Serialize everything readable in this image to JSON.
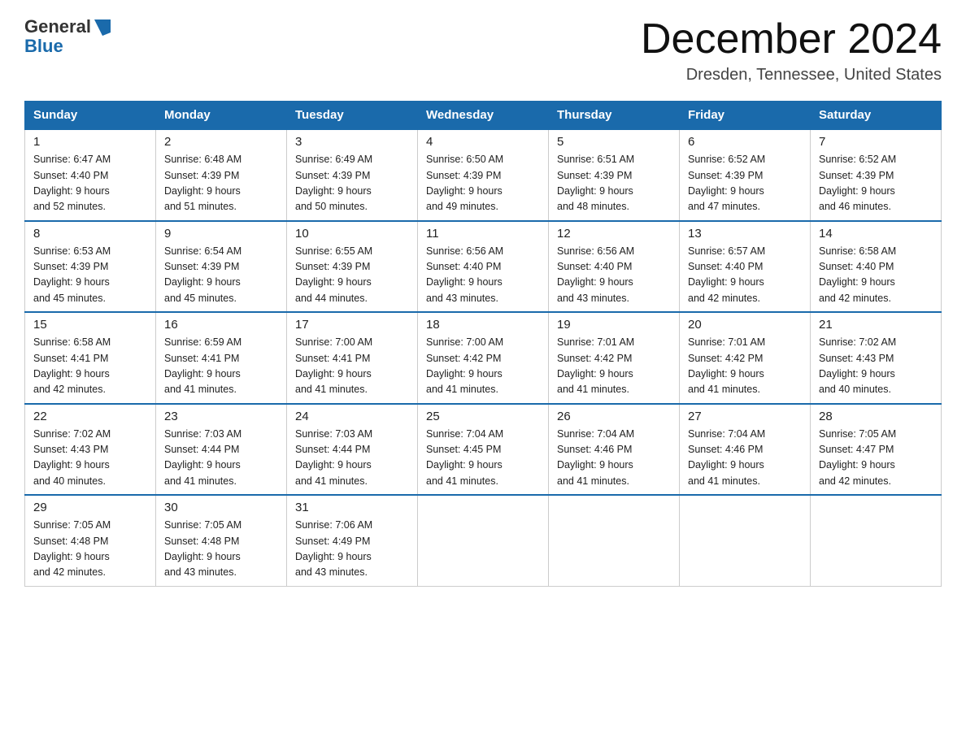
{
  "header": {
    "logo_line1": "General",
    "logo_line2": "Blue",
    "month_title": "December 2024",
    "location": "Dresden, Tennessee, United States"
  },
  "weekdays": [
    "Sunday",
    "Monday",
    "Tuesday",
    "Wednesday",
    "Thursday",
    "Friday",
    "Saturday"
  ],
  "weeks": [
    [
      {
        "day": "1",
        "sunrise": "6:47 AM",
        "sunset": "4:40 PM",
        "daylight": "9 hours and 52 minutes."
      },
      {
        "day": "2",
        "sunrise": "6:48 AM",
        "sunset": "4:39 PM",
        "daylight": "9 hours and 51 minutes."
      },
      {
        "day": "3",
        "sunrise": "6:49 AM",
        "sunset": "4:39 PM",
        "daylight": "9 hours and 50 minutes."
      },
      {
        "day": "4",
        "sunrise": "6:50 AM",
        "sunset": "4:39 PM",
        "daylight": "9 hours and 49 minutes."
      },
      {
        "day": "5",
        "sunrise": "6:51 AM",
        "sunset": "4:39 PM",
        "daylight": "9 hours and 48 minutes."
      },
      {
        "day": "6",
        "sunrise": "6:52 AM",
        "sunset": "4:39 PM",
        "daylight": "9 hours and 47 minutes."
      },
      {
        "day": "7",
        "sunrise": "6:52 AM",
        "sunset": "4:39 PM",
        "daylight": "9 hours and 46 minutes."
      }
    ],
    [
      {
        "day": "8",
        "sunrise": "6:53 AM",
        "sunset": "4:39 PM",
        "daylight": "9 hours and 45 minutes."
      },
      {
        "day": "9",
        "sunrise": "6:54 AM",
        "sunset": "4:39 PM",
        "daylight": "9 hours and 45 minutes."
      },
      {
        "day": "10",
        "sunrise": "6:55 AM",
        "sunset": "4:39 PM",
        "daylight": "9 hours and 44 minutes."
      },
      {
        "day": "11",
        "sunrise": "6:56 AM",
        "sunset": "4:40 PM",
        "daylight": "9 hours and 43 minutes."
      },
      {
        "day": "12",
        "sunrise": "6:56 AM",
        "sunset": "4:40 PM",
        "daylight": "9 hours and 43 minutes."
      },
      {
        "day": "13",
        "sunrise": "6:57 AM",
        "sunset": "4:40 PM",
        "daylight": "9 hours and 42 minutes."
      },
      {
        "day": "14",
        "sunrise": "6:58 AM",
        "sunset": "4:40 PM",
        "daylight": "9 hours and 42 minutes."
      }
    ],
    [
      {
        "day": "15",
        "sunrise": "6:58 AM",
        "sunset": "4:41 PM",
        "daylight": "9 hours and 42 minutes."
      },
      {
        "day": "16",
        "sunrise": "6:59 AM",
        "sunset": "4:41 PM",
        "daylight": "9 hours and 41 minutes."
      },
      {
        "day": "17",
        "sunrise": "7:00 AM",
        "sunset": "4:41 PM",
        "daylight": "9 hours and 41 minutes."
      },
      {
        "day": "18",
        "sunrise": "7:00 AM",
        "sunset": "4:42 PM",
        "daylight": "9 hours and 41 minutes."
      },
      {
        "day": "19",
        "sunrise": "7:01 AM",
        "sunset": "4:42 PM",
        "daylight": "9 hours and 41 minutes."
      },
      {
        "day": "20",
        "sunrise": "7:01 AM",
        "sunset": "4:42 PM",
        "daylight": "9 hours and 41 minutes."
      },
      {
        "day": "21",
        "sunrise": "7:02 AM",
        "sunset": "4:43 PM",
        "daylight": "9 hours and 40 minutes."
      }
    ],
    [
      {
        "day": "22",
        "sunrise": "7:02 AM",
        "sunset": "4:43 PM",
        "daylight": "9 hours and 40 minutes."
      },
      {
        "day": "23",
        "sunrise": "7:03 AM",
        "sunset": "4:44 PM",
        "daylight": "9 hours and 41 minutes."
      },
      {
        "day": "24",
        "sunrise": "7:03 AM",
        "sunset": "4:44 PM",
        "daylight": "9 hours and 41 minutes."
      },
      {
        "day": "25",
        "sunrise": "7:04 AM",
        "sunset": "4:45 PM",
        "daylight": "9 hours and 41 minutes."
      },
      {
        "day": "26",
        "sunrise": "7:04 AM",
        "sunset": "4:46 PM",
        "daylight": "9 hours and 41 minutes."
      },
      {
        "day": "27",
        "sunrise": "7:04 AM",
        "sunset": "4:46 PM",
        "daylight": "9 hours and 41 minutes."
      },
      {
        "day": "28",
        "sunrise": "7:05 AM",
        "sunset": "4:47 PM",
        "daylight": "9 hours and 42 minutes."
      }
    ],
    [
      {
        "day": "29",
        "sunrise": "7:05 AM",
        "sunset": "4:48 PM",
        "daylight": "9 hours and 42 minutes."
      },
      {
        "day": "30",
        "sunrise": "7:05 AM",
        "sunset": "4:48 PM",
        "daylight": "9 hours and 43 minutes."
      },
      {
        "day": "31",
        "sunrise": "7:06 AM",
        "sunset": "4:49 PM",
        "daylight": "9 hours and 43 minutes."
      },
      null,
      null,
      null,
      null
    ]
  ]
}
